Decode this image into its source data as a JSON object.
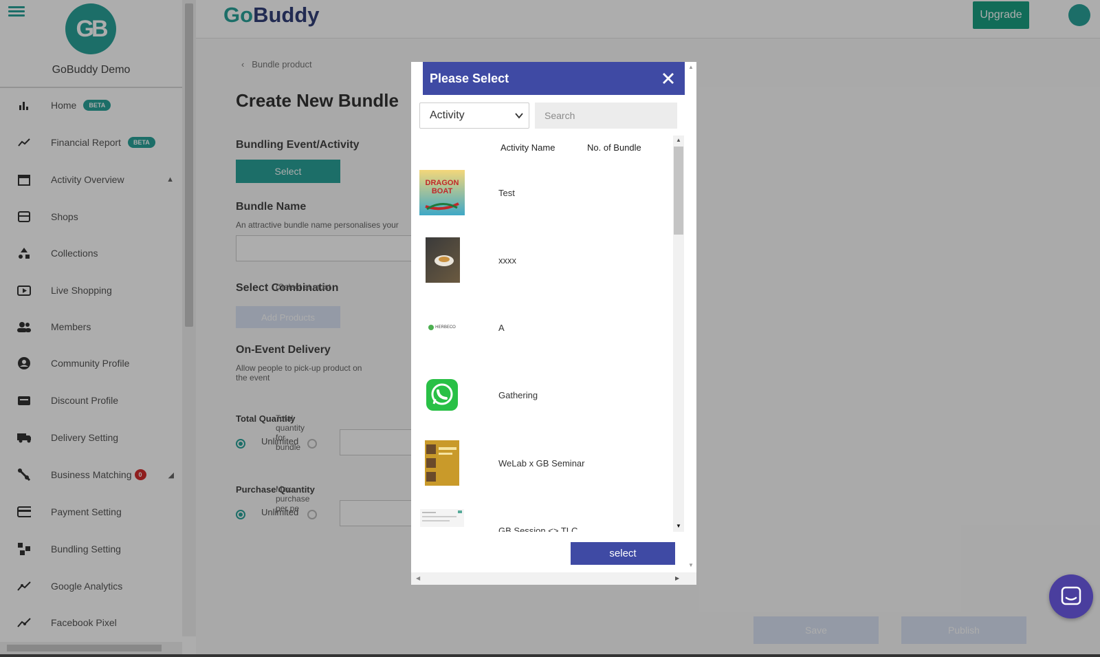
{
  "app": {
    "brand_prefix": "Go",
    "brand_suffix": "Buddy",
    "logo_text": "GB",
    "org_name": "GoBuddy Demo",
    "upgrade_label": "Upgrade"
  },
  "sidebar": {
    "items": [
      {
        "label": "Home",
        "icon": "bar-chart-icon",
        "badge": "BETA"
      },
      {
        "label": "Financial Report",
        "icon": "trend-line-icon",
        "badge": "BETA"
      },
      {
        "label": "Activity Overview",
        "icon": "calendar-icon"
      },
      {
        "label": "Shops",
        "icon": "store-icon"
      },
      {
        "label": "Collections",
        "icon": "shapes-icon"
      },
      {
        "label": "Live Shopping",
        "icon": "live-video-icon"
      },
      {
        "label": "Members",
        "icon": "people-icon"
      },
      {
        "label": "Community Profile",
        "icon": "account-circle-icon"
      },
      {
        "label": "Discount Profile",
        "icon": "ticket-icon"
      },
      {
        "label": "Delivery Setting",
        "icon": "truck-icon"
      },
      {
        "label": "Business Matching",
        "icon": "handshake-icon",
        "badge": "0"
      },
      {
        "label": "Payment Setting",
        "icon": "credit-card-icon"
      },
      {
        "label": "Bundling Setting",
        "icon": "bundle-icon"
      },
      {
        "label": "Google Analytics",
        "icon": "analytics-icon"
      },
      {
        "label": "Facebook Pixel",
        "icon": "pixel-icon"
      }
    ]
  },
  "page": {
    "breadcrumb": "Bundle product",
    "title": "Create New Bundle",
    "bundling_label": "Bundling Event/Activity",
    "bundling_select": "Select",
    "bundle_name_label": "Bundle Name",
    "bundle_name_help": "An attractive bundle name personalises your",
    "combination_label": "Select Combination",
    "combination_help": "(Select at most",
    "add_products": "Add Products",
    "delivery_label": "On-Event Delivery",
    "delivery_help": "Allow people to pick-up product on the event",
    "total_qty_label": "Total Quantity",
    "total_qty_help": "Total quantity for bundle",
    "unlimited": "Unlimited",
    "purchase_qty_label": "Purchase Quantity",
    "purchase_qty_help": "Max purchase per pe",
    "save": "Save",
    "publish": "Publish"
  },
  "modal": {
    "title": "Please Select",
    "category_value": "Activity",
    "search_placeholder": "Search",
    "col_activity_name": "Activity Name",
    "col_no_of_bundle": "No. of Bundle",
    "rows": [
      {
        "name": "Test",
        "thumb": "dragon-boat-poster"
      },
      {
        "name": "xxxx",
        "thumb": "coffee-photo"
      },
      {
        "name": "A",
        "thumb": "herbeco-logo"
      },
      {
        "name": "Gathering",
        "thumb": "whatsapp-icon"
      },
      {
        "name": "WeLab x GB Seminar",
        "thumb": "seminar-poster"
      },
      {
        "name": "GB Session <> TLC",
        "thumb": "screenshot-thumb"
      }
    ],
    "select_label": "select"
  },
  "thumb_text": {
    "dragon_line1": "DRAGON",
    "dragon_line2": "BOAT",
    "herbeco": "HERBECO"
  },
  "colors": {
    "teal": "#2aa39a",
    "indigo": "#3f4aa4",
    "upgrade_green": "#1aa082",
    "badge_red": "#d32f2f"
  }
}
